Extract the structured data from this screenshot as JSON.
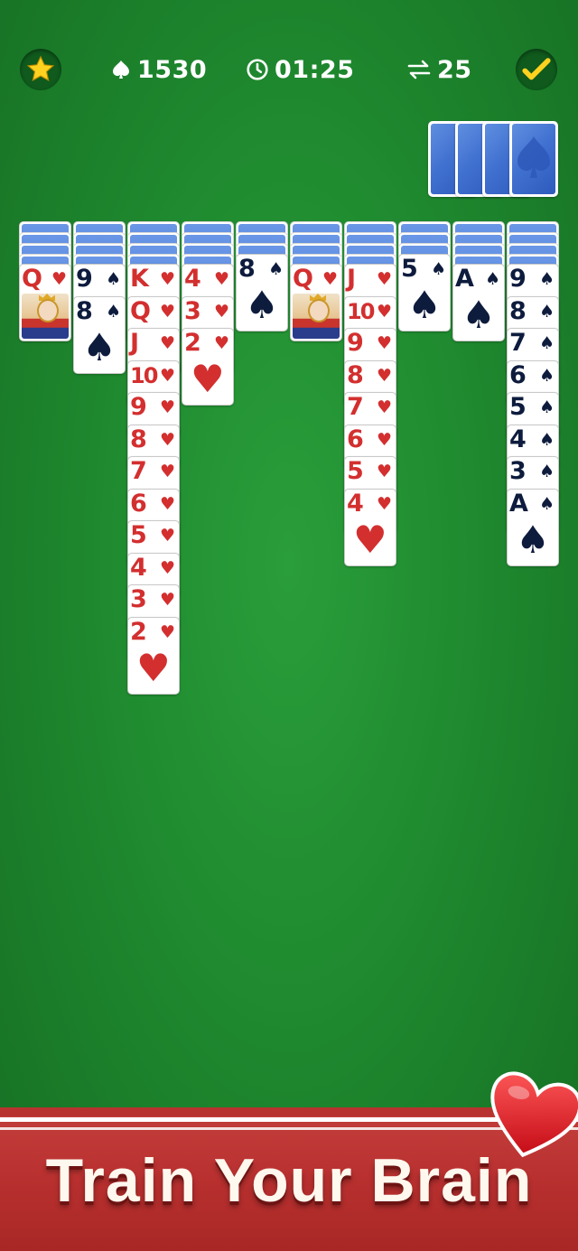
{
  "hud": {
    "score": "1530",
    "timer": "01:25",
    "moves": "25",
    "star_icon": "star-icon",
    "check_icon": "checkmark-icon"
  },
  "stock": {
    "piles": 4
  },
  "tableau": [
    {
      "down": 4,
      "up": [
        {
          "rank": "Q",
          "suit": "heart",
          "face": true
        }
      ]
    },
    {
      "down": 4,
      "up": [
        {
          "rank": "9",
          "suit": "spade"
        },
        {
          "rank": "8",
          "suit": "spade",
          "last": true
        }
      ]
    },
    {
      "down": 4,
      "up": [
        {
          "rank": "K",
          "suit": "heart"
        },
        {
          "rank": "Q",
          "suit": "heart"
        },
        {
          "rank": "J",
          "suit": "heart"
        },
        {
          "rank": "10",
          "suit": "heart"
        },
        {
          "rank": "9",
          "suit": "heart"
        },
        {
          "rank": "8",
          "suit": "heart"
        },
        {
          "rank": "7",
          "suit": "heart"
        },
        {
          "rank": "6",
          "suit": "heart"
        },
        {
          "rank": "5",
          "suit": "heart"
        },
        {
          "rank": "4",
          "suit": "heart"
        },
        {
          "rank": "3",
          "suit": "heart"
        },
        {
          "rank": "2",
          "suit": "heart",
          "last": true
        }
      ]
    },
    {
      "down": 4,
      "up": [
        {
          "rank": "4",
          "suit": "heart"
        },
        {
          "rank": "3",
          "suit": "heart"
        },
        {
          "rank": "2",
          "suit": "heart",
          "last": true
        }
      ]
    },
    {
      "down": 3,
      "up": [
        {
          "rank": "8",
          "suit": "spade",
          "last": true
        }
      ]
    },
    {
      "down": 4,
      "up": [
        {
          "rank": "Q",
          "suit": "heart",
          "face": true
        }
      ]
    },
    {
      "down": 4,
      "up": [
        {
          "rank": "J",
          "suit": "heart"
        },
        {
          "rank": "10",
          "suit": "heart"
        },
        {
          "rank": "9",
          "suit": "heart"
        },
        {
          "rank": "8",
          "suit": "heart"
        },
        {
          "rank": "7",
          "suit": "heart"
        },
        {
          "rank": "6",
          "suit": "heart"
        },
        {
          "rank": "5",
          "suit": "heart"
        },
        {
          "rank": "4",
          "suit": "heart",
          "last": true
        }
      ]
    },
    {
      "down": 3,
      "up": [
        {
          "rank": "5",
          "suit": "spade",
          "last": true
        }
      ]
    },
    {
      "down": 4,
      "up": [
        {
          "rank": "A",
          "suit": "spade",
          "last": true
        }
      ]
    },
    {
      "down": 4,
      "up": [
        {
          "rank": "9",
          "suit": "spade"
        },
        {
          "rank": "8",
          "suit": "spade"
        },
        {
          "rank": "7",
          "suit": "spade"
        },
        {
          "rank": "6",
          "suit": "spade"
        },
        {
          "rank": "5",
          "suit": "spade"
        },
        {
          "rank": "4",
          "suit": "spade"
        },
        {
          "rank": "3",
          "suit": "spade"
        },
        {
          "rank": "A",
          "suit": "spade",
          "last": true
        }
      ]
    }
  ],
  "banner": {
    "title": "Train Your Brain"
  },
  "colors": {
    "felt": "#1f8a2f",
    "red_suit": "#d32f2f",
    "black_suit": "#0d1b3d",
    "banner": "#b8302f",
    "card_back": "#3f6fcf"
  }
}
